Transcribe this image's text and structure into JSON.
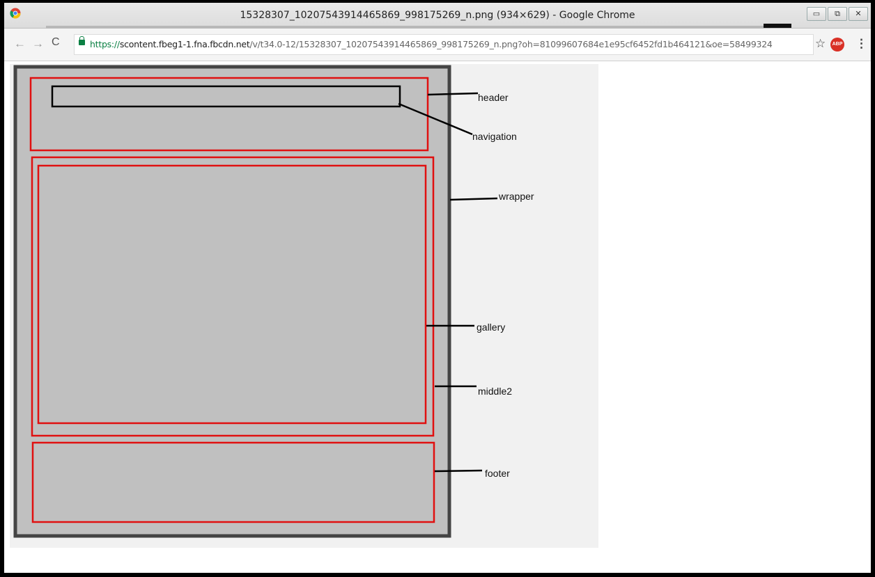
{
  "browser": {
    "window_title": "15328307_10207543914465869_998175269_n.png (934×629) - Google Chrome",
    "url_scheme": "https://",
    "url_host": "scontent.fbeg1-1.fna.fbcdn.net",
    "url_path": "/v/t34.0-12/15328307_10207543914465869_998175269_n.png?oh=81099607684e1e95cf6452fd1b464121&oe=58499324",
    "window_buttons": {
      "minimize": "▭",
      "restore": "⧉",
      "close": "✕"
    },
    "nav": {
      "back": "←",
      "forward": "→",
      "reload": "C"
    },
    "toolbar_icons": {
      "star": "☆",
      "adblock": "ABP",
      "menu": "⋮"
    }
  },
  "diagram": {
    "labels": {
      "header": "header",
      "navigation": "navigation",
      "wrapper": "wrapper",
      "gallery": "gallery",
      "middle2": "middle2",
      "footer": "footer"
    },
    "colors": {
      "wrapper_border": "#444444",
      "section_border": "#e01010",
      "nav_border": "#000000",
      "fill": "#c0c0c0"
    }
  }
}
